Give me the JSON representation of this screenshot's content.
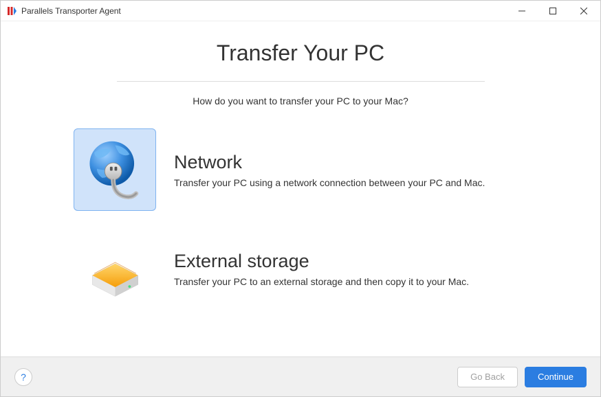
{
  "window": {
    "title": "Parallels Transporter Agent"
  },
  "page": {
    "title": "Transfer Your PC",
    "subtitle": "How do you want to transfer your PC to your Mac?"
  },
  "options": {
    "network": {
      "title": "Network",
      "description": "Transfer your PC using a network connection between your PC and Mac.",
      "selected": true
    },
    "storage": {
      "title": "External storage",
      "description": "Transfer your PC to an external storage and then copy it to your Mac.",
      "selected": false
    }
  },
  "footer": {
    "help": "?",
    "back": "Go Back",
    "continue": "Continue"
  }
}
